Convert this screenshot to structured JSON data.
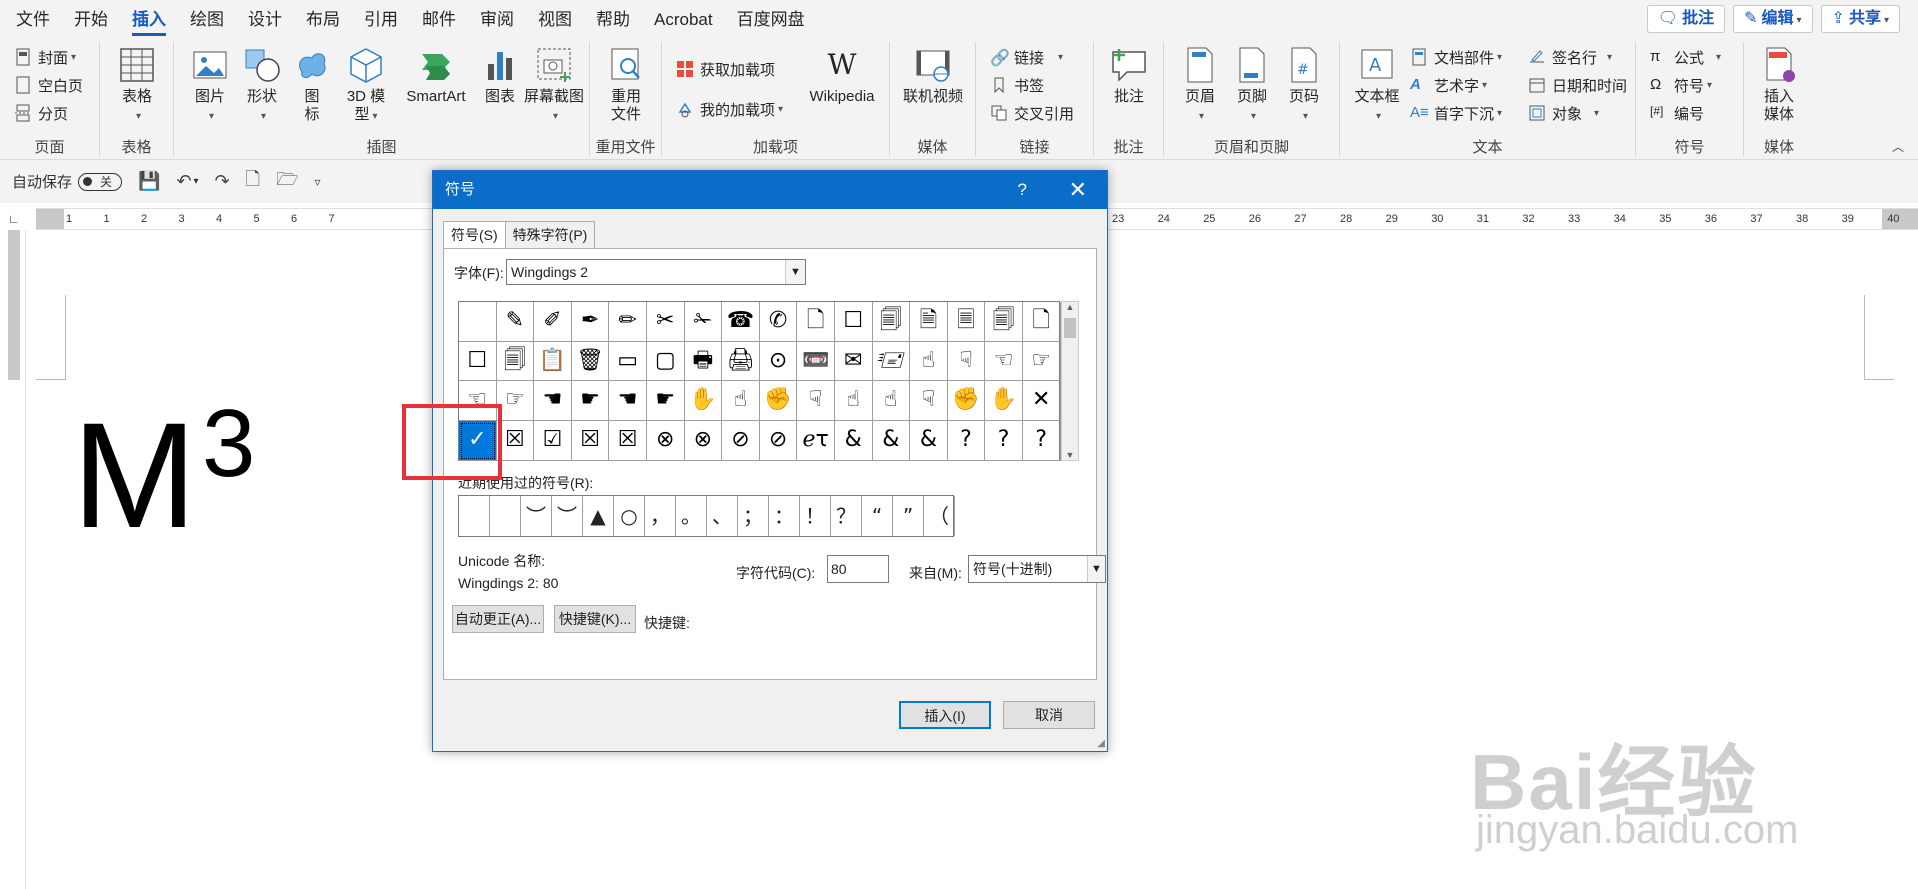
{
  "menubar": {
    "tabs": [
      "文件",
      "开始",
      "插入",
      "绘图",
      "设计",
      "布局",
      "引用",
      "邮件",
      "审阅",
      "视图",
      "帮助",
      "Acrobat",
      "百度网盘"
    ],
    "active_tab": "插入",
    "comment_btn": "批注",
    "edit_btn": "编辑",
    "share_btn": "共享"
  },
  "ribbon": {
    "pages": {
      "cover": "封面",
      "blank": "空白页",
      "break": "分页",
      "label": "页面"
    },
    "tables": {
      "table": "表格",
      "label": "表格"
    },
    "illustrations": {
      "picture": "图片",
      "shapes": "形状",
      "icons_1": "图",
      "icons_2": "标",
      "model_1": "3D 模",
      "model_2": "型",
      "smartart": "SmartArt",
      "chart": "图表",
      "screenshot": "屏幕截图",
      "label": "插图"
    },
    "reuse": {
      "reuse_1": "重用",
      "reuse_2": "文件",
      "label": "重用文件"
    },
    "addins": {
      "get": "获取加载项",
      "mine": "我的加载项",
      "wikipedia": "Wikipedia",
      "label": "加载项"
    },
    "media": {
      "video": "联机视频",
      "label": "媒体"
    },
    "links": {
      "link": "链接",
      "bookmark": "书签",
      "crossref": "交叉引用",
      "label": "链接"
    },
    "comments": {
      "comment": "批注",
      "label": "批注"
    },
    "headerfooter": {
      "header": "页眉",
      "footer": "页脚",
      "pagenum": "页码",
      "label": "页眉和页脚"
    },
    "text": {
      "textbox": "文本框",
      "parts": "文档部件",
      "wordart": "艺术字",
      "dropcap": "首字下沉",
      "sigline": "签名行",
      "datetime": "日期和时间",
      "object": "对象",
      "label": "文本"
    },
    "symbols": {
      "equation": "公式",
      "symbol": "符号",
      "number": "编号",
      "label": "符号"
    },
    "media2": {
      "insert_1": "插入",
      "insert_2": "媒体",
      "label": "媒体"
    }
  },
  "qat": {
    "autosave": "自动保存",
    "toggle": "关"
  },
  "ruler": {
    "left_ticks": [
      "1",
      "1",
      "2",
      "3",
      "4",
      "5",
      "6",
      "7"
    ],
    "right_ticks": [
      "23",
      "24",
      "25",
      "26",
      "27",
      "28",
      "29",
      "30",
      "31",
      "32",
      "33",
      "34",
      "35",
      "36",
      "37",
      "38",
      "39",
      "40"
    ]
  },
  "document": {
    "main_text": "M",
    "superscript": "3"
  },
  "dialog": {
    "title": "符号",
    "help": "?",
    "close": "✕",
    "tab_symbols": "符号(S)",
    "tab_special": "特殊字符(P)",
    "font_label": "字体(F):",
    "font_value": "Wingdings 2",
    "symbols": [
      "",
      "✎",
      "✐",
      "✒",
      "✏",
      "✂",
      "✁",
      "☎",
      "✆",
      "🗋",
      "☐",
      "🗐",
      "🗎",
      "🗏",
      "🗐",
      "🗋",
      "☐",
      "🗐",
      "📋",
      "🗑",
      "▭",
      "▢",
      "🖶",
      "🖨",
      "⊙",
      "📼",
      "✉",
      "🖅",
      "☝",
      "☟",
      "☜",
      "☞",
      "☜",
      "☞",
      "☚",
      "☛",
      "☚",
      "☛",
      "✋",
      "☝",
      "✊",
      "☟",
      "☝",
      "☝",
      "☟",
      "✊",
      "✋",
      "✕",
      "✓",
      "☒",
      "☑",
      "☒",
      "☒",
      "⊗",
      "⊗",
      "⊘",
      "⊘",
      "ℯτ",
      "&",
      "&",
      "&",
      "?",
      "?",
      "?"
    ],
    "selected_index": 48,
    "recent_label": "近期使用过的符号(R):",
    "recent": [
      "",
      "",
      "︶",
      "︶",
      "▲",
      "○",
      "，",
      "。",
      "、",
      "；",
      "：",
      "！",
      "？",
      "“",
      "”",
      "（"
    ],
    "unicode_name_label": "Unicode 名称:",
    "unicode_name_value": "Wingdings 2: 80",
    "code_label": "字符代码(C):",
    "code_value": "80",
    "from_label": "来自(M):",
    "from_value": "符号(十进制)",
    "autocorrect_btn": "自动更正(A)...",
    "shortcut_btn": "快捷键(K)...",
    "shortcut_label": "快捷键:",
    "insert_btn": "插入(I)",
    "cancel_btn": "取消"
  },
  "watermark": {
    "logo": "Bai经验",
    "url": "jingyan.baidu.com"
  },
  "colors": {
    "accent": "#185abd",
    "title_bar": "#0a6ec9",
    "selected": "#0078d7",
    "highlight_box": "#e8323a"
  }
}
